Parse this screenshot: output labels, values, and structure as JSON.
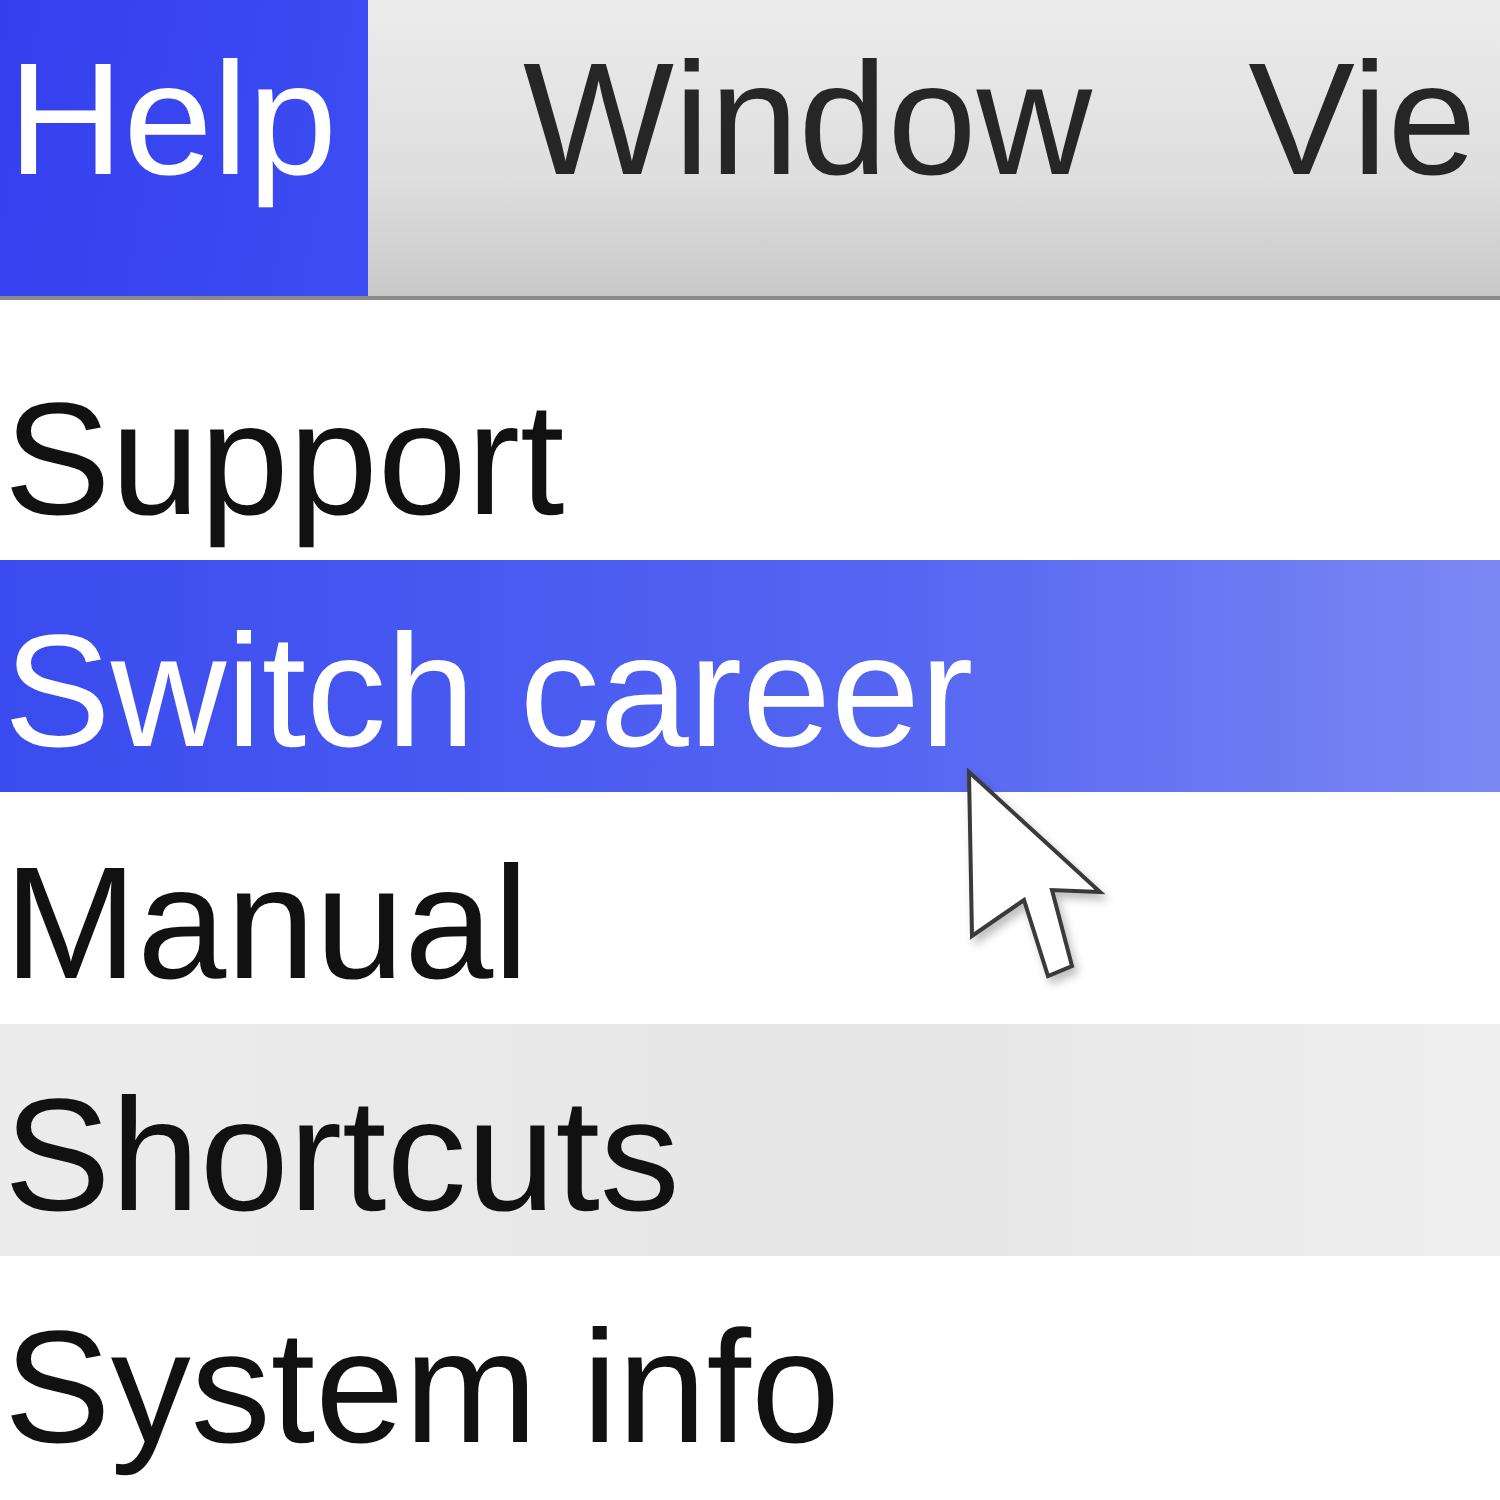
{
  "menu_bar": {
    "items": [
      {
        "label": "Help",
        "selected": true
      },
      {
        "label": "Window",
        "selected": false
      },
      {
        "label": "Vie",
        "selected": false
      }
    ]
  },
  "menu": {
    "items": [
      {
        "label": "Support",
        "selected": false
      },
      {
        "label": "Switch career",
        "selected": true
      },
      {
        "label": "Manual",
        "selected": false
      },
      {
        "label": "Shortcuts",
        "selected": false
      },
      {
        "label": "System info",
        "selected": false
      }
    ]
  }
}
